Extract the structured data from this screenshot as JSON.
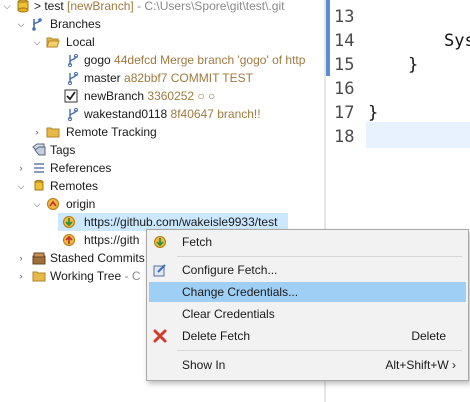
{
  "tree": {
    "repo": {
      "name": "test",
      "branch": "[newBranch]",
      "path": "- C:\\Users\\Spore\\git\\test\\.git"
    },
    "branches_label": "Branches",
    "local_label": "Local",
    "local_branches": [
      {
        "name": "gogo",
        "info": "44defcd Merge branch 'gogo' of http"
      },
      {
        "name": "master",
        "info": "a82bbf7 COMMIT TEST"
      },
      {
        "name": "newBranch",
        "info": "3360252 ○ ○"
      },
      {
        "name": "wakestand0118",
        "info": "8f40647 branch!!"
      }
    ],
    "remote_tracking_label": "Remote Tracking",
    "tags_label": "Tags",
    "references_label": "References",
    "remotes_label": "Remotes",
    "origin_label": "origin",
    "fetch_url": "https://github.com/wakeisle9933/test",
    "push_url_partial": "https://gith",
    "stashed_label": "Stashed Commits",
    "working_tree_label": "Working Tree",
    "working_tree_suffix": "- C"
  },
  "editor": {
    "line_numbers": [
      "13",
      "14",
      "15",
      "16",
      "17",
      "18"
    ],
    "lines": [
      "",
      "Sys",
      "}",
      "",
      "}",
      ""
    ]
  },
  "context_menu": {
    "items": [
      {
        "label": "Fetch",
        "icon": "fetch-icon"
      },
      {
        "label": "Configure Fetch...",
        "icon": "configure-icon"
      },
      {
        "label": "Change Credentials...",
        "icon": ""
      },
      {
        "label": "Clear Credentials",
        "icon": ""
      },
      {
        "label": "Delete Fetch",
        "icon": "delete-icon",
        "shortcut": "Delete"
      },
      {
        "label": "Show In",
        "shortcut": "Alt+Shift+W ›"
      }
    ]
  },
  "colors": {
    "selection": "#cce8ff",
    "menu_highlight": "#9fcff4",
    "ruler": "#5b8ed6"
  }
}
